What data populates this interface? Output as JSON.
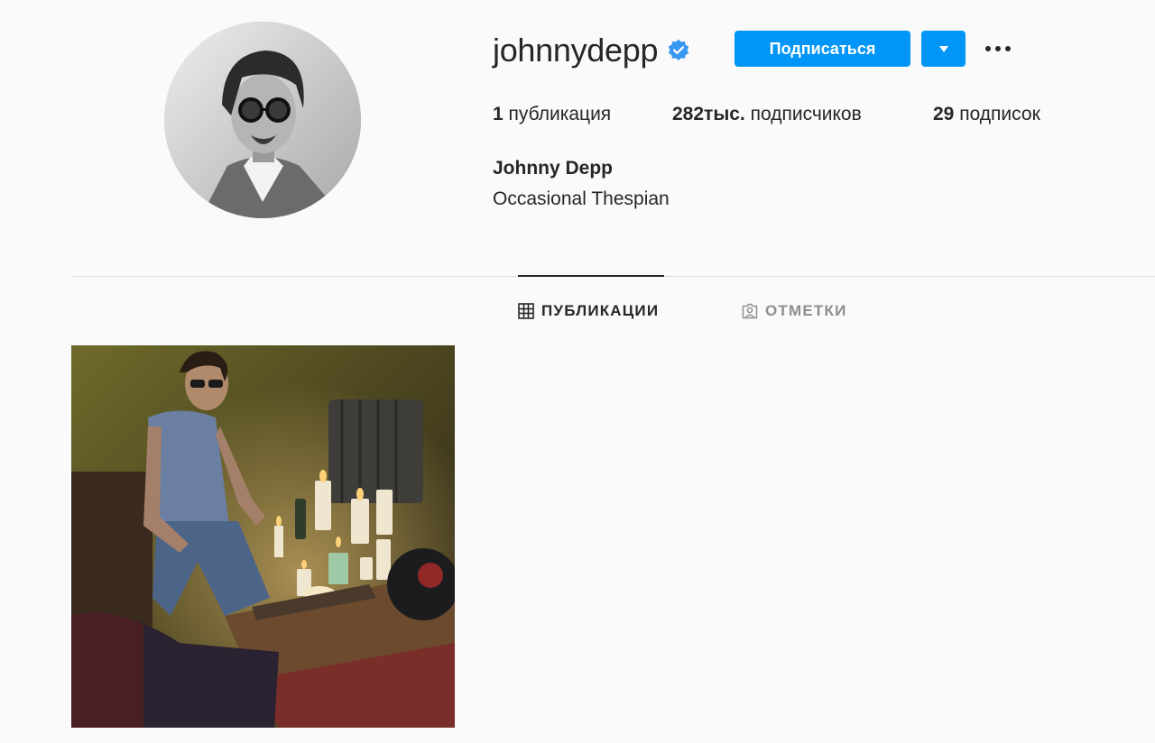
{
  "profile": {
    "username": "johnnydepp",
    "verified": true,
    "full_name": "Johnny Depp",
    "bio": "Occasional Thespian",
    "avatar_icon": "profile-photo"
  },
  "actions": {
    "follow_label": "Подписаться",
    "dropdown_icon": "chevron-down-icon",
    "more_icon": "more-options-icon"
  },
  "stats": {
    "posts_count": "1",
    "posts_label": "публикация",
    "followers_count": "282тыс.",
    "followers_label": "подписчиков",
    "following_count": "29",
    "following_label": "подписок"
  },
  "tabs": [
    {
      "label": "ПУБЛИКАЦИИ",
      "icon": "grid-icon",
      "active": true
    },
    {
      "label": "ОТМЕТКИ",
      "icon": "tagged-person-icon",
      "active": false
    }
  ],
  "posts": [
    {
      "icon": "post-photo"
    }
  ],
  "colors": {
    "accent": "#0095f6",
    "verified": "#3897f0",
    "text": "#262626",
    "muted": "#8e8e8e",
    "background": "#fafafa",
    "divider": "#dbdbdb"
  }
}
